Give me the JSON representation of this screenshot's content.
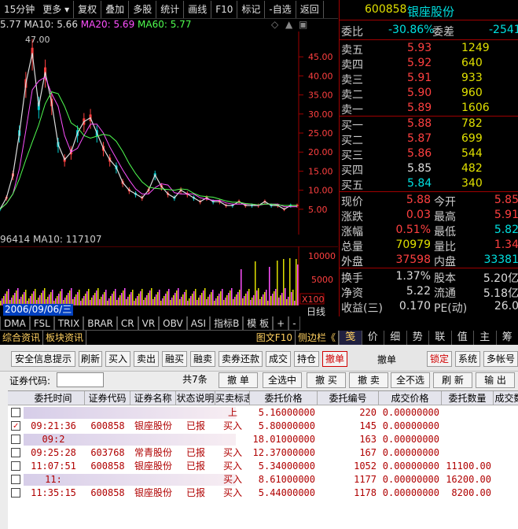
{
  "toolbar": {
    "period": "15分钟",
    "more": "更多",
    "buttons": [
      "复权",
      "叠加",
      "多股",
      "统计",
      "画线",
      "F10",
      "标记",
      "-自选",
      "返回"
    ]
  },
  "ma_line": {
    "price": "5.77",
    "ma10": "MA10: 5.66",
    "ma20": "MA20: 5.69",
    "ma60": "MA60: 5.77"
  },
  "chart_data": {
    "type": "line",
    "title": "",
    "ylabel": "",
    "ylim": [
      0,
      50
    ],
    "y_ticks": [
      "45.00",
      "40.00",
      "35.00",
      "30.00",
      "25.00",
      "20.00",
      "15.00",
      "10.00",
      "5.00"
    ],
    "peak_label": "47.00",
    "volume_ticks": [
      "10000",
      "5000"
    ],
    "volume_unit": "X100",
    "series": [
      {
        "name": "",
        "values": [
          5,
          8,
          14,
          25,
          38,
          46,
          32,
          41,
          33,
          22,
          18,
          20,
          25,
          28,
          29,
          25,
          21,
          18,
          16,
          12,
          10,
          9,
          8,
          10,
          14,
          11,
          9,
          8,
          10,
          9,
          8,
          7,
          8,
          7,
          7,
          6,
          6,
          7,
          6,
          6,
          6,
          7,
          6,
          6,
          5,
          6,
          6
        ]
      }
    ]
  },
  "vol_header": {
    "text": "96414",
    "ma10": "MA10: 117107"
  },
  "date_bar": {
    "date": "2006/09/06/三",
    "right": "日线"
  },
  "ind_tabs": [
    "DMA",
    "FSL",
    "TRIX",
    "BRAR",
    "CR",
    "VR",
    "OBV",
    "ASI",
    "指标B",
    "模 板",
    "+",
    "-"
  ],
  "tabrow2": [
    "综合资讯",
    "板块资讯",
    "图文F10",
    "侧边栏《"
  ],
  "quote": {
    "code": "600858",
    "name": "银座股份",
    "weibi_label": "委比",
    "weibi": "-30.86%",
    "weicha_label": "委差",
    "weicha": "-2541",
    "sells": [
      {
        "label": "卖五",
        "price": "5.93",
        "vol": "1249"
      },
      {
        "label": "卖四",
        "price": "5.92",
        "vol": "640"
      },
      {
        "label": "卖三",
        "price": "5.91",
        "vol": "933"
      },
      {
        "label": "卖二",
        "price": "5.90",
        "vol": "960"
      },
      {
        "label": "卖一",
        "price": "5.89",
        "vol": "1606"
      }
    ],
    "buys": [
      {
        "label": "买一",
        "price": "5.88",
        "vol": "782"
      },
      {
        "label": "买二",
        "price": "5.87",
        "vol": "699"
      },
      {
        "label": "买三",
        "price": "5.86",
        "vol": "544"
      },
      {
        "label": "买四",
        "price": "5.85",
        "vol": "482"
      },
      {
        "label": "买五",
        "price": "5.84",
        "vol": "340"
      }
    ],
    "stats": [
      {
        "l1": "现价",
        "v1": "5.88",
        "l2": "今开",
        "v2": "5.85"
      },
      {
        "l1": "涨跌",
        "v1": "0.03",
        "l2": "最高",
        "v2": "5.91"
      },
      {
        "l1": "涨幅",
        "v1": "0.51%",
        "l2": "最低",
        "v2": "5.82"
      },
      {
        "l1": "总量",
        "v1": "70979",
        "l2": "量比",
        "v2": "1.34"
      },
      {
        "l1": "外盘",
        "v1": "37598",
        "l2": "内盘",
        "v2": "33381"
      }
    ],
    "stats2": [
      {
        "l1": "换手",
        "v1": "1.37%",
        "l2": "股本",
        "v2": "5.20亿"
      },
      {
        "l1": "净资",
        "v1": "5.22",
        "l2": "流通",
        "v2": "5.18亿"
      },
      {
        "l1": "收益(三)",
        "v1": "0.170",
        "l2": "PE(动)",
        "v2": "26.0"
      }
    ],
    "tabs": [
      "笺",
      "价",
      "细",
      "势",
      "联",
      "值",
      "主",
      "筹"
    ]
  },
  "trade": {
    "top_buttons": [
      "安全信息提示",
      "刷新",
      "买入",
      "卖出",
      "融买",
      "融卖",
      "卖券还款",
      "成交",
      "持仓",
      "撤单",
      "撤单",
      "锁定",
      "系统",
      "多帐号"
    ],
    "code_label": "证券代码:",
    "second_buttons": [
      "共7条",
      "撤 单",
      "全选中",
      "撤 买",
      "撤 卖",
      "全不选",
      "刷 新",
      "输 出"
    ],
    "columns": [
      "委托时间",
      "证券代码",
      "证券名称",
      "状态说明",
      "买卖标志",
      "委托价格",
      "委托编号",
      "成交价格",
      "委托数量",
      "成交数"
    ],
    "rows": [
      {
        "checked": false,
        "time": "",
        "code": "",
        "name": "",
        "status": "",
        "flag": "上",
        "price": "5.16000000",
        "no": "220",
        "deal": "0.00000000",
        "qty": "",
        "blur": true
      },
      {
        "checked": true,
        "time": "09:21:36",
        "code": "600858",
        "name": "银座股份",
        "status": "已报",
        "flag": "买入",
        "price": "5.80000000",
        "no": "145",
        "deal": "0.00000000",
        "qty": "",
        "blur": false
      },
      {
        "checked": false,
        "time": "09:2",
        "code": "",
        "name": "",
        "status": "",
        "flag": "",
        "price": "18.01000000",
        "no": "163",
        "deal": "0.00000000",
        "qty": "",
        "blur": true
      },
      {
        "checked": false,
        "time": "09:25:28",
        "code": "603768",
        "name": "常青股份",
        "status": "已报",
        "flag": "买入",
        "price": "12.37000000",
        "no": "167",
        "deal": "0.00000000",
        "qty": "",
        "blur": false
      },
      {
        "checked": false,
        "time": "11:07:51",
        "code": "600858",
        "name": "银座股份",
        "status": "已报",
        "flag": "买入",
        "price": "5.34000000",
        "no": "1052",
        "deal": "0.00000000",
        "qty": "11100.00",
        "blur": false
      },
      {
        "checked": false,
        "time": "11:",
        "code": "",
        "name": "",
        "status": "",
        "flag": "买入",
        "price": "8.61000000",
        "no": "1177",
        "deal": "0.00000000",
        "qty": "16200.00",
        "blur": true
      },
      {
        "checked": false,
        "time": "11:35:15",
        "code": "600858",
        "name": "银座股份",
        "status": "已报",
        "flag": "买入",
        "price": "5.44000000",
        "no": "1178",
        "deal": "0.00000000",
        "qty": "8200.00",
        "blur": false
      }
    ]
  }
}
